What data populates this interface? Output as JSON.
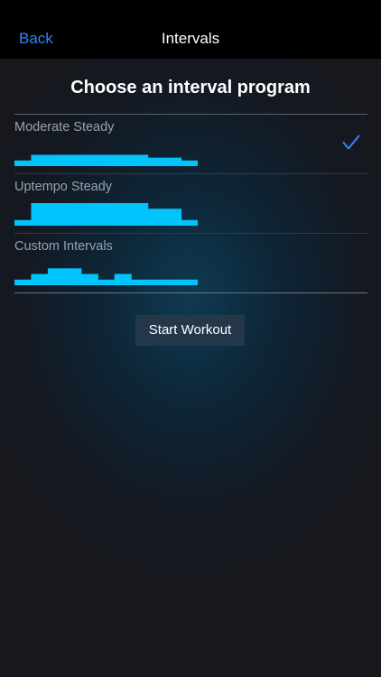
{
  "nav": {
    "back_label": "Back",
    "title": "Intervals"
  },
  "heading": "Choose an interval program",
  "programs": [
    {
      "name": "Moderate Steady",
      "selected": true,
      "profile": [
        1,
        2,
        2,
        2,
        2,
        2,
        2,
        2,
        1.5,
        1.5,
        1
      ]
    },
    {
      "name": "Uptempo Steady",
      "selected": false,
      "profile": [
        1,
        4,
        4,
        4,
        4,
        4,
        4,
        4,
        3,
        3,
        1
      ]
    },
    {
      "name": "Custom Intervals",
      "selected": false,
      "profile": [
        1,
        2,
        3,
        3,
        2,
        1,
        2,
        1,
        1,
        1,
        1
      ]
    }
  ],
  "start_button": {
    "label": "Start Workout"
  },
  "colors": {
    "accent": "#2f86f6",
    "profile_fill": "#00c4fb",
    "navbar": "#000000",
    "button_bg": "#24384a"
  },
  "icons": {
    "selected": "checkmark-icon"
  }
}
